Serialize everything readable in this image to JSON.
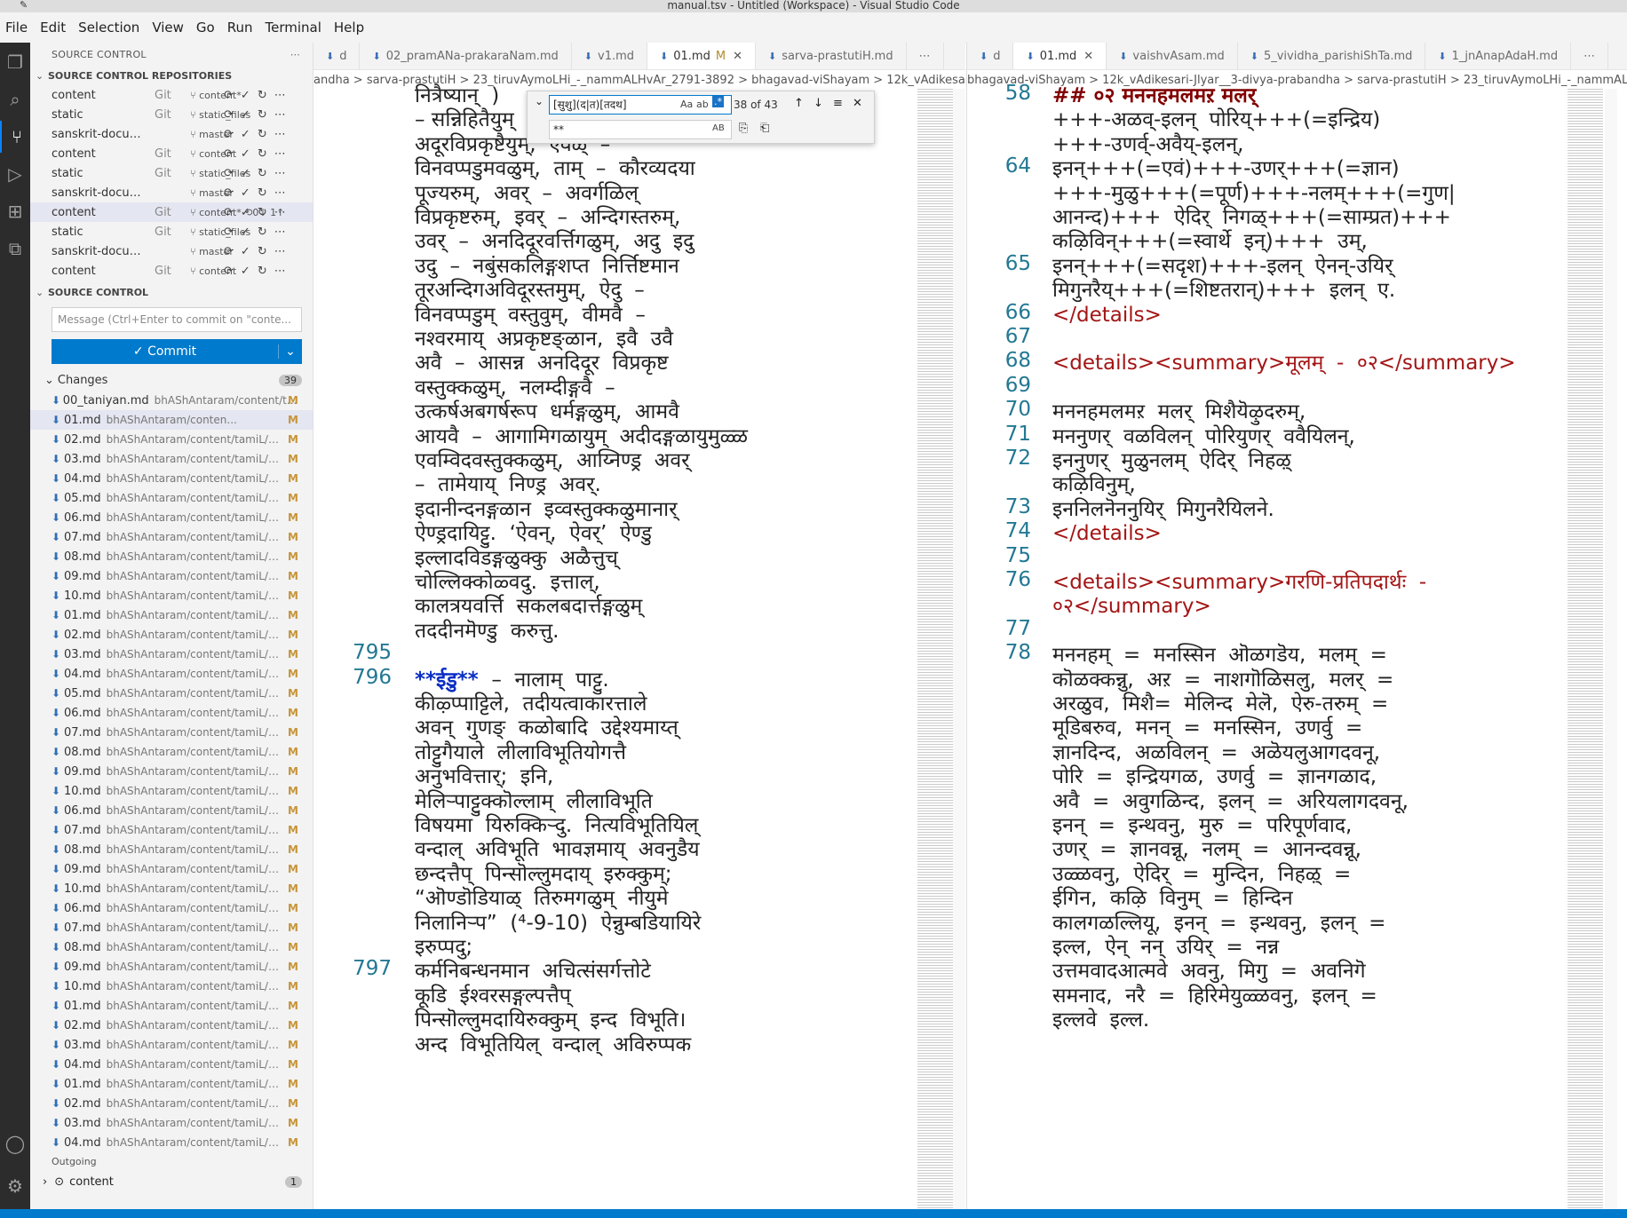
{
  "window": {
    "title": "manual.tsv - Untitled (Workspace) - Visual Studio Code"
  },
  "menu": [
    "File",
    "Edit",
    "Selection",
    "View",
    "Go",
    "Run",
    "Terminal",
    "Help"
  ],
  "activity_icons": [
    "files-icon",
    "search-icon",
    "source-control-icon",
    "run-debug-icon",
    "extensions-icon",
    "remote-explorer-icon",
    "account-icon",
    "settings-icon"
  ],
  "sidebar": {
    "header": "SOURCE CONTROL",
    "repos_header": "SOURCE CONTROL REPOSITORIES",
    "repos": [
      {
        "name": "content",
        "type": "Git",
        "branch": "content*"
      },
      {
        "name": "static",
        "type": "Git",
        "branch": "static_files"
      },
      {
        "name": "sanskrit-documen...",
        "type": "",
        "branch": "master"
      },
      {
        "name": "content",
        "type": "Git",
        "branch": "content"
      },
      {
        "name": "static",
        "type": "Git",
        "branch": "static_files"
      },
      {
        "name": "sanskrit-documen...",
        "type": "",
        "branch": "master"
      },
      {
        "name": "content",
        "type": "Git",
        "branch": "content* ⟲0↓ 1↑"
      },
      {
        "name": "static",
        "type": "Git",
        "branch": "static_files"
      },
      {
        "name": "sanskrit-documen...",
        "type": "",
        "branch": "master"
      },
      {
        "name": "content",
        "type": "Git",
        "branch": "content"
      }
    ],
    "sc_header": "SOURCE CONTROL",
    "commit_placeholder": "Message (Ctrl+Enter to commit on \"conte...",
    "commit_label": "✓ Commit",
    "changes_label": "Changes",
    "changes_count": "39",
    "files": [
      {
        "name": "00_taniyan.md",
        "path": "bhAShAntaram/content/t...",
        "status": "M"
      },
      {
        "name": "01.md",
        "path": "bhAShAntaram/conten...",
        "status": "M"
      },
      {
        "name": "02.md",
        "path": "bhAShAntaram/content/tamiL/pa...",
        "status": "M"
      },
      {
        "name": "03.md",
        "path": "bhAShAntaram/content/tamiL/pa...",
        "status": "M"
      },
      {
        "name": "04.md",
        "path": "bhAShAntaram/content/tamiL/pa...",
        "status": "M"
      },
      {
        "name": "05.md",
        "path": "bhAShAntaram/content/tamiL/pa...",
        "status": "M"
      },
      {
        "name": "06.md",
        "path": "bhAShAntaram/content/tamiL/pa...",
        "status": "M"
      },
      {
        "name": "07.md",
        "path": "bhAShAntaram/content/tamiL/pa...",
        "status": "M"
      },
      {
        "name": "08.md",
        "path": "bhAShAntaram/content/tamiL/pa...",
        "status": "M"
      },
      {
        "name": "09.md",
        "path": "bhAShAntaram/content/tamiL/pa...",
        "status": "M"
      },
      {
        "name": "10.md",
        "path": "bhAShAntaram/content/tamiL/pa...",
        "status": "M"
      },
      {
        "name": "01.md",
        "path": "bhAShAntaram/content/tamiL/pa...",
        "status": "M"
      },
      {
        "name": "02.md",
        "path": "bhAShAntaram/content/tamiL/pa...",
        "status": "M"
      },
      {
        "name": "03.md",
        "path": "bhAShAntaram/content/tamiL/pa...",
        "status": "M"
      },
      {
        "name": "04.md",
        "path": "bhAShAntaram/content/tamiL/pa...",
        "status": "M"
      },
      {
        "name": "05.md",
        "path": "bhAShAntaram/content/tamiL/pa...",
        "status": "M"
      },
      {
        "name": "06.md",
        "path": "bhAShAntaram/content/tamiL/pa...",
        "status": "M"
      },
      {
        "name": "07.md",
        "path": "bhAShAntaram/content/tamiL/pa...",
        "status": "M"
      },
      {
        "name": "08.md",
        "path": "bhAShAntaram/content/tamiL/pa...",
        "status": "M"
      },
      {
        "name": "09.md",
        "path": "bhAShAntaram/content/tamiL/pa...",
        "status": "M"
      },
      {
        "name": "10.md",
        "path": "bhAShAntaram/content/tamiL/pa...",
        "status": "M"
      },
      {
        "name": "06.md",
        "path": "bhAShAntaram/content/tamiL/pa...",
        "status": "M"
      },
      {
        "name": "07.md",
        "path": "bhAShAntaram/content/tamiL/pa...",
        "status": "M"
      },
      {
        "name": "08.md",
        "path": "bhAShAntaram/content/tamiL/pa...",
        "status": "M"
      },
      {
        "name": "09.md",
        "path": "bhAShAntaram/content/tamiL/pa...",
        "status": "M"
      },
      {
        "name": "10.md",
        "path": "bhAShAntaram/content/tamiL/pa...",
        "status": "M"
      },
      {
        "name": "06.md",
        "path": "bhAShAntaram/content/tamiL/pa...",
        "status": "M"
      },
      {
        "name": "07.md",
        "path": "bhAShAntaram/content/tamiL/pa...",
        "status": "M"
      },
      {
        "name": "08.md",
        "path": "bhAShAntaram/content/tamiL/pa...",
        "status": "M"
      },
      {
        "name": "09.md",
        "path": "bhAShAntaram/content/tamiL/pa...",
        "status": "M"
      },
      {
        "name": "10.md",
        "path": "bhAShAntaram/content/tamiL/pa...",
        "status": "M"
      },
      {
        "name": "01.md",
        "path": "bhAShAntaram/content/tamiL/pa...",
        "status": "M"
      },
      {
        "name": "02.md",
        "path": "bhAShAntaram/content/tamiL/pa...",
        "status": "M"
      },
      {
        "name": "03.md",
        "path": "bhAShAntaram/content/tamiL/pa...",
        "status": "M"
      },
      {
        "name": "04.md",
        "path": "bhAShAntaram/content/tamiL/pa...",
        "status": "M"
      },
      {
        "name": "01.md",
        "path": "bhAShAntaram/content/tamiL/pa...",
        "status": "M"
      },
      {
        "name": "02.md",
        "path": "bhAShAntaram/content/tamiL/pa...",
        "status": "M"
      },
      {
        "name": "03.md",
        "path": "bhAShAntaram/content/tamiL/pa...",
        "status": "M"
      },
      {
        "name": "04.md",
        "path": "bhAShAntaram/content/tamiL/pa...",
        "status": "M"
      }
    ],
    "outgoing_label": "Outgoing",
    "outgoing_item": "content",
    "outgoing_count": "1"
  },
  "left_editor": {
    "tabs": [
      {
        "label": "d",
        "active": false,
        "modified": false
      },
      {
        "label": "02_pramANa-prakaraNam.md",
        "active": false,
        "modified": false
      },
      {
        "label": "v1.md",
        "active": false,
        "modified": false
      },
      {
        "label": "01.md",
        "active": true,
        "modified": true
      },
      {
        "label": "sarva-prastutiH.md",
        "active": false,
        "modified": false
      }
    ],
    "breadcrumb": "andha > sarva-prastutiH > 23_tiruvAymoLHi_-_nammALHvAr_2791-3892 > bhagavad-viShayam > 12k_vAdikesari-Jlyar__3-divya-prabandha > sarva-prastutiH",
    "find": {
      "query": "[सुशु](द|त)[तदथ]",
      "count": "38 of 43",
      "replace": "**"
    },
    "lines": [
      {
        "n": "",
        "t": "नित्रैष्यान्  ) "
      },
      {
        "n": "",
        "t": "– सन्निहितैयुम्"
      },
      {
        "n": "",
        "t": "अदूरविप्रकृष्टैयुम्,  ऐवळ्  –"
      },
      {
        "n": "",
        "t": "विनवप्पडुमवळुम्,  ताम्  –  कौरव्यदया"
      },
      {
        "n": "",
        "t": "पूज्यरुम्,  अवर्  –  अवर्गळिल्"
      },
      {
        "n": "",
        "t": "विप्रकृष्टरुम्,  इवर्  –  अन्दिगस्तरुम्,"
      },
      {
        "n": "",
        "t": "उवर्  –  अनदिदूरवर्त्तिगळुम्,  अदु  इदु"
      },
      {
        "n": "",
        "t": "उदु  –  नबुंसकलिङ्गशप्त  निर्त्तिष्टमान"
      },
      {
        "n": "",
        "t": "तूरअन्दिगअविदूरस्तमुम्,  ऐदु  –"
      },
      {
        "n": "",
        "t": "विनवप्पडुम्  वस्तुवुम्,  वीमवै  –"
      },
      {
        "n": "",
        "t": "नश्वरमाय्  अप्रकृष्टङ्ळान,  इवै  उवै"
      },
      {
        "n": "",
        "t": "अवै  –  आसन्न  अनदिदूर  विप्रकृष्ट"
      },
      {
        "n": "",
        "t": "वस्तुक्कळुम्,  नलम्दीङ्गवै  –"
      },
      {
        "n": "",
        "t": "उत्कर्षअबगर्षरूप  धर्मङ्गळुम्,  आमवै"
      },
      {
        "n": "",
        "t": "आयवै  –  आगामिगळायुम्  अदीदङ्गळायुमुळ्ळ"
      },
      {
        "n": "",
        "t": "एवम्विदवस्तुक्कळुम्,  आय्निण्ड्र  अवर्"
      },
      {
        "n": "",
        "t": "–  तामेयाय्  निण्ड्र  अवर्."
      },
      {
        "n": "",
        "t": "इदानीन्दनङ्गळान  इव्वस्तुक्कळुमानार्"
      },
      {
        "n": "",
        "t": "ऐण्ड्रदायिट्टु.  ‘ऐवन्,  ऐवर्’  ऐण्डु"
      },
      {
        "n": "",
        "t": "इल्लादविडङ्गळुक्कु  अळैत्तुच्"
      },
      {
        "n": "",
        "t": "चोल्लिक्कोळ्वदु.  इत्ताल्,"
      },
      {
        "n": "",
        "t": "कालत्रयवर्त्ति  सकलबदार्त्तङ्गळुम्"
      },
      {
        "n": "",
        "t": "तददीनमॆण्डु  करुत्तु."
      },
      {
        "n": "795",
        "t": ""
      },
      {
        "n": "796",
        "t": "**ईडु**  –  नालाम्  पाट्टु."
      },
      {
        "n": "",
        "t": "कीऴ्प्पाट्टिले,  तदीयत्वाकारत्ताले"
      },
      {
        "n": "",
        "t": "अवन्  गुणङ्  कळोबादि  उद्देश्यमाय्त्"
      },
      {
        "n": "",
        "t": "तोट्टुगैयाले  लीलाविभूतियोगत्तै"
      },
      {
        "n": "",
        "t": "अनुभवित्तार्;  इनि,"
      },
      {
        "n": "",
        "t": "मेलिऱ्पाट्टुक्कॊल्लाम्  लीलाविभूति"
      },
      {
        "n": "",
        "t": "विषयमा  यिरुक्किऱ्दु.  नित्यविभूतियिल्"
      },
      {
        "n": "",
        "t": "वन्दाल्  अविभूति  भावज्ञमाय्  अवनुडैय"
      },
      {
        "n": "",
        "t": "छन्दत्तैप्  पिन्सॊल्लुमदाय्  इरुक्कुम्;"
      },
      {
        "n": "",
        "t": "“ऒण्डॊडियाळ्  तिरुमगळुम्  नीयुमे"
      },
      {
        "n": "",
        "t": "निलानिऱ्प”  (⁴-9-10)  ऐन्नुम्बडियायिरे"
      },
      {
        "n": "",
        "t": "इरुप्पदु;"
      },
      {
        "n": "797",
        "t": "कर्मनिबन्धनमान  अचित्संसर्गत्तोटे"
      },
      {
        "n": "",
        "t": "कूडि  ईश्वरसङ्गल्पत्तैप्"
      },
      {
        "n": "",
        "t": "पिन्सॊल्लुमदायिरुक्कुम्  इन्द  विभूति।"
      },
      {
        "n": "",
        "t": "अन्द  विभूतियिल्  वन्दाल्  अविरुप्पक"
      }
    ]
  },
  "right_editor": {
    "tabs": [
      {
        "label": "d",
        "active": false,
        "modified": false
      },
      {
        "label": "01.md",
        "active": true,
        "modified": false
      },
      {
        "label": "vaishvAsam.md",
        "active": false,
        "modified": false
      },
      {
        "label": "5_vividha_parishiShTa.md",
        "active": false,
        "modified": false
      },
      {
        "label": "1_jnAnapAdaH.md",
        "active": false,
        "modified": false
      }
    ],
    "breadcrumb": "bhagavad-viShayam > 12k_vAdikesari-Jlyar__3-divya-prabandha > sarva-prastutiH > 23_tiruvAymoLHi_-_nammALHvAr_2791-3892 > sarva-prastutiH > 01 > 01.md",
    "lines": [
      {
        "n": "58",
        "t": "## ०२ मननहमलमऱ मलर्",
        "cls": "hd"
      },
      {
        "n": "",
        "t": "+++-अळव्-इलन्  पोरिय्+++(=इन्द्रिय)"
      },
      {
        "n": "",
        "t": "+++-उणर्व्-अवैय्-इलन्,"
      },
      {
        "n": "64",
        "t": "इनन्+++(=एवं)+++-उणर्+++(=ज्ञान)"
      },
      {
        "n": "",
        "t": "+++-मुळु+++(=पूर्ण)+++-नलम्+++(=गुण|"
      },
      {
        "n": "",
        "t": "आनन्द)+++  ऐदिर्  निगळ्+++(=साम्प्रत)+++"
      },
      {
        "n": "",
        "t": "कऴिविन्+++(=स्वार्थे  इन्)+++  उम्,"
      },
      {
        "n": "65",
        "t": "इनन्+++(=सदृश)+++-इलन्  ऐनन्-उयिर्"
      },
      {
        "n": "",
        "t": "मिगुनरैय्+++(=शिष्टतरान्)+++  इलन्  ए."
      },
      {
        "n": "66",
        "t": "</details>",
        "cls": "red"
      },
      {
        "n": "67",
        "t": ""
      },
      {
        "n": "68",
        "t": "<details><summary>मूलम्  -  ०२</summary>",
        "cls": "red"
      },
      {
        "n": "69",
        "t": ""
      },
      {
        "n": "70",
        "t": "मननहमलमऱ  मलर्  मिशैयॆऴुदरुम्,"
      },
      {
        "n": "71",
        "t": "मननुणर्  वळविलन्  पोरियुणर्  ववैयिलन्,"
      },
      {
        "n": "72",
        "t": "इननुणर्  मुळुनलम्  ऐदिर्  निहऴ्"
      },
      {
        "n": "",
        "t": "कऴिविनुम्,"
      },
      {
        "n": "73",
        "t": "इननिलनॆननुयिर्  मिगुनरैयिलने."
      },
      {
        "n": "74",
        "t": "</details>",
        "cls": "red"
      },
      {
        "n": "75",
        "t": ""
      },
      {
        "n": "76",
        "t": "<details><summary>गरणि-प्रतिपदार्थः  -",
        "cls": "red"
      },
      {
        "n": "",
        "t": "०२</summary>",
        "cls": "red"
      },
      {
        "n": "77",
        "t": ""
      },
      {
        "n": "78",
        "t": "मननहम्  =  मनस्सिन  ऒळगडॆय,  मलम्  ="
      },
      {
        "n": "",
        "t": "कॊळक्कन्नु,  अऱ  =  नाशगॊळिसलु,  मलर्  ="
      },
      {
        "n": "",
        "t": "अरळुव,  मिशै=  मेलिन्द  मेलॆ,  ऐरु-तरुम्  ="
      },
      {
        "n": "",
        "t": "मूडिबरुव,  मनन्  =  मनस्सिन,  उणर्वु  ="
      },
      {
        "n": "",
        "t": "ज्ञानदिन्द,  अळविलन्  =  अळॆयलुआगदवनू,"
      },
      {
        "n": "",
        "t": "पोरि  =  इन्द्रियगळ,  उणर्वु  =  ज्ञानगळाद,"
      },
      {
        "n": "",
        "t": "अवै  =  अवुगळिन्द,  इलन्  =  अरियलागदवनू,"
      },
      {
        "n": "",
        "t": "इनन्  =  इन्थवनु,  मुरु  =  परिपूर्णवाद,"
      },
      {
        "n": "",
        "t": "उणर्  =  ज्ञानवन्नू,  नलम्  =  आनन्दवन्नू,"
      },
      {
        "n": "",
        "t": "उळ्ळवनु,  ऐदिर्  =  मुन्दिन,  निहऴ्  ="
      },
      {
        "n": "",
        "t": "ईगिन,  कऴि  विनुम्  =  हिन्दिन"
      },
      {
        "n": "",
        "t": "कालगळल्लियू,  इनन्  =  इन्थवनु,  इलन्  ="
      },
      {
        "n": "",
        "t": "इल्ल,  ऐन्  नन्  उयिर्  =  नन्न"
      },
      {
        "n": "",
        "t": "उत्तमवादआत्मवे  अवनु,  मिगु  =  अवनिगॆ"
      },
      {
        "n": "",
        "t": "समनाद,  नरै  =  हिरिमेयुळ्ळवनु,  इलन्  ="
      },
      {
        "n": "",
        "t": "इल्लवे  इल्ल."
      }
    ]
  }
}
